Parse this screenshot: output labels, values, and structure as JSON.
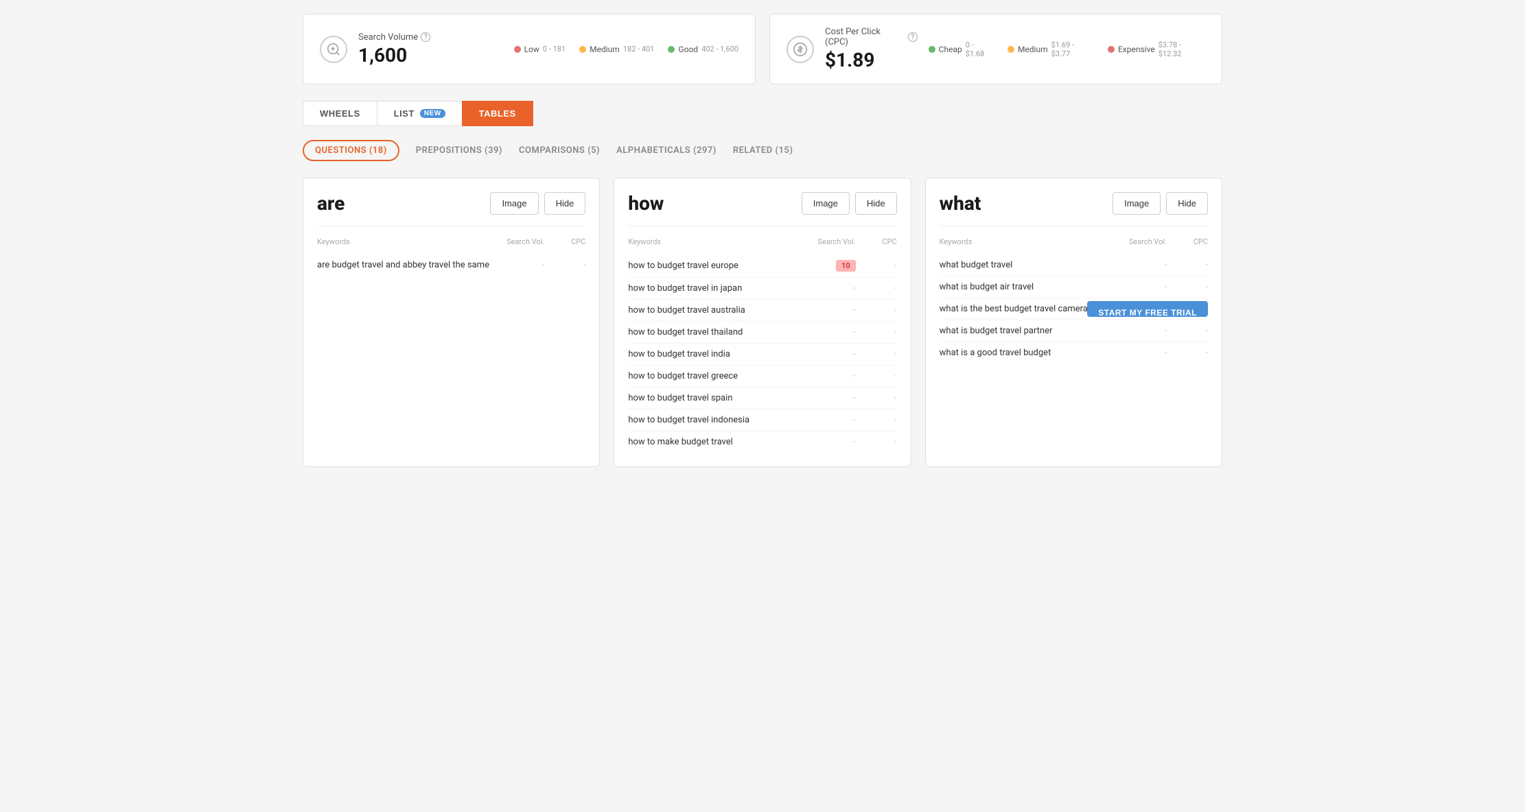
{
  "stats": {
    "search_volume": {
      "icon": "⏸",
      "label": "Search Volume",
      "value": "1,600",
      "legend": [
        {
          "color": "#e57373",
          "label": "Low",
          "range": "0 - 181"
        },
        {
          "color": "#ffb74d",
          "label": "Medium",
          "range": "182 - 401"
        },
        {
          "color": "#66bb6a",
          "label": "Good",
          "range": "402 - 1,600"
        }
      ]
    },
    "cpc": {
      "icon": "$",
      "label": "Cost Per Click (CPC)",
      "value": "$1.89",
      "legend": [
        {
          "color": "#66bb6a",
          "label": "Cheap",
          "range": "0 - $1.68"
        },
        {
          "color": "#ffb74d",
          "label": "Medium",
          "range": "$1.69 - $3.77"
        },
        {
          "color": "#e57373",
          "label": "Expensive",
          "range": "$3.78 - $12.32"
        }
      ]
    }
  },
  "tabs": [
    {
      "id": "wheels",
      "label": "WHEELS",
      "active": false,
      "badge": null
    },
    {
      "id": "list",
      "label": "LIST",
      "active": false,
      "badge": "NEW"
    },
    {
      "id": "tables",
      "label": "TABLES",
      "active": true,
      "badge": null
    }
  ],
  "filter_tabs": [
    {
      "id": "questions",
      "label": "QUESTIONS (18)",
      "active": true
    },
    {
      "id": "prepositions",
      "label": "PREPOSITIONS (39)",
      "active": false
    },
    {
      "id": "comparisons",
      "label": "COMPARISONS (5)",
      "active": false
    },
    {
      "id": "alphabeticals",
      "label": "ALPHABETICALS (297)",
      "active": false
    },
    {
      "id": "related",
      "label": "RELATED (15)",
      "active": false
    }
  ],
  "cards": [
    {
      "id": "are",
      "word": "are",
      "keywords": [
        {
          "text": "are budget travel and abbey travel the same",
          "vol": "-",
          "cpc": "-"
        }
      ]
    },
    {
      "id": "how",
      "word": "how",
      "keywords": [
        {
          "text": "how to budget travel europe",
          "vol": "10",
          "vol_badge": true,
          "cpc": "-"
        },
        {
          "text": "how to budget travel in japan",
          "vol": "-",
          "cpc": "-"
        },
        {
          "text": "how to budget travel australia",
          "vol": "-",
          "cpc": "-"
        },
        {
          "text": "how to budget travel thailand",
          "vol": "-",
          "cpc": "-"
        },
        {
          "text": "how to budget travel india",
          "vol": "-",
          "cpc": "-"
        },
        {
          "text": "how to budget travel greece",
          "vol": "-",
          "cpc": "-"
        },
        {
          "text": "how to budget travel spain",
          "vol": "-",
          "cpc": "-"
        },
        {
          "text": "how to budget travel indonesia",
          "vol": "-",
          "cpc": "-"
        },
        {
          "text": "how to make budget travel",
          "vol": "-",
          "cpc": "-"
        }
      ]
    },
    {
      "id": "what",
      "word": "what",
      "keywords": [
        {
          "text": "what budget travel",
          "vol": "-",
          "cpc": "-"
        },
        {
          "text": "what is budget air travel",
          "vol": "-",
          "cpc": "-"
        },
        {
          "text": "what is the best budget travel camera",
          "vol": "-",
          "cpc": "-"
        },
        {
          "text": "what is budget travel partner",
          "vol": "-",
          "cpc": "-"
        },
        {
          "text": "what is a good travel budget",
          "vol": "-",
          "cpc": "-"
        }
      ]
    }
  ],
  "buttons": {
    "image": "Image",
    "hide": "Hide",
    "trial": "START MY FREE TRIAL"
  },
  "col_headers": {
    "keywords": "Keywords",
    "search_vol": "Search Vol.",
    "cpc": "CPC"
  }
}
